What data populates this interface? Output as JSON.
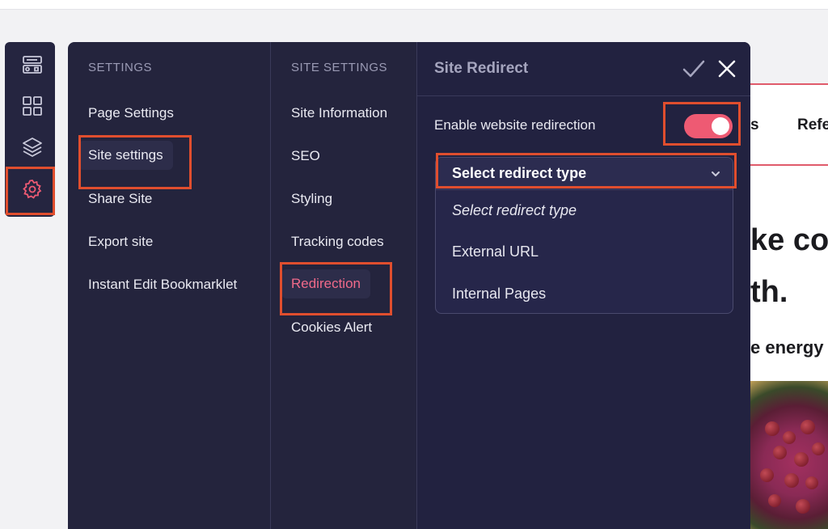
{
  "background_site": {
    "nav_fragment_1": "s",
    "nav_fragment_2": "Refe",
    "heading_line_1": "ke co",
    "heading_line_2": "th.",
    "subheading": "e energy"
  },
  "rail": {
    "items": [
      {
        "icon": "layout-form-icon"
      },
      {
        "icon": "grid-icon"
      },
      {
        "icon": "layers-icon"
      },
      {
        "icon": "gear-icon",
        "active": true
      }
    ]
  },
  "settings": {
    "header": "SETTINGS",
    "items": [
      "Page Settings",
      "Site settings",
      "Share Site",
      "Export site",
      "Instant Edit Bookmarklet"
    ]
  },
  "site_settings": {
    "header": "SITE SETTINGS",
    "items": [
      "Site Information",
      "SEO",
      "Styling",
      "Tracking codes",
      "Redirection",
      "Cookies Alert"
    ]
  },
  "redirect_panel": {
    "title": "Site Redirect",
    "enable_label": "Enable website redirection",
    "toggle_on": true,
    "dropdown": {
      "selected": "Select redirect type",
      "options": [
        "Select redirect type",
        "External URL",
        "Internal Pages"
      ]
    }
  },
  "colors": {
    "panel_bg": "#24243d",
    "accent_pink": "#ee5a73",
    "highlight_orange": "#e04e2e"
  }
}
